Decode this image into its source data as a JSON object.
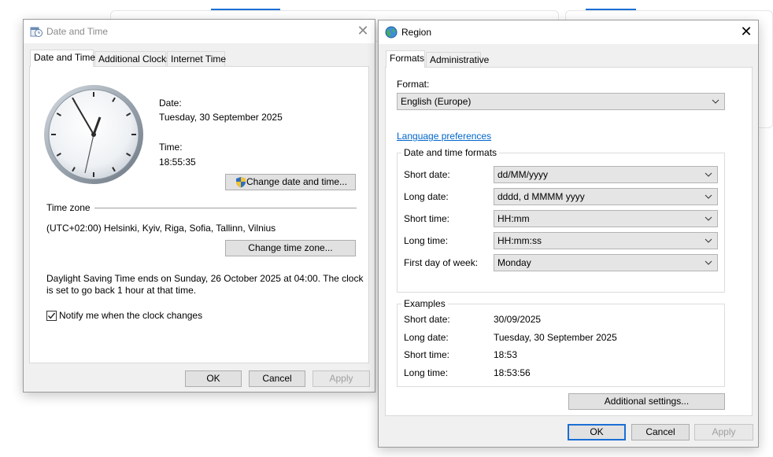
{
  "date_time_dialog": {
    "title": "Date and Time",
    "close": "✕",
    "tabs": [
      "Date and Time",
      "Additional Clocks",
      "Internet Time"
    ],
    "date_label": "Date:",
    "date_value": "Tuesday, 30 September 2025",
    "time_label": "Time:",
    "time_value": "18:55:35",
    "change_date_button": "Change date and time...",
    "time_zone_heading": "Time zone",
    "time_zone_value": "(UTC+02:00) Helsinki, Kyiv, Riga, Sofia, Tallinn, Vilnius",
    "change_zone_button": "Change time zone...",
    "dst_line1": "Daylight Saving Time ends on Sunday, 26 October 2025 at 04:00. The clock",
    "dst_line2": "is set to go back 1 hour at that time.",
    "notify_label": "Notify me when the clock changes",
    "notify_checked": true,
    "ok": "OK",
    "cancel": "Cancel",
    "apply": "Apply"
  },
  "region_dialog": {
    "title": "Region",
    "close": "✕",
    "tabs": [
      "Formats",
      "Administrative"
    ],
    "format_label": "Format:",
    "format_value": "English (Europe)",
    "language_link": "Language preferences",
    "dt_group_title": "Date and time formats",
    "short_date_label": "Short date:",
    "short_date_value": "dd/MM/yyyy",
    "long_date_label": "Long date:",
    "long_date_value": "dddd, d MMMM yyyy",
    "short_time_label": "Short time:",
    "short_time_value": "HH:mm",
    "long_time_label": "Long time:",
    "long_time_value": "HH:mm:ss",
    "first_day_label": "First day of week:",
    "first_day_value": "Monday",
    "examples_title": "Examples",
    "ex_short_date_label": "Short date:",
    "ex_short_date_value": "30/09/2025",
    "ex_long_date_label": "Long date:",
    "ex_long_date_value": "Tuesday, 30 September 2025",
    "ex_short_time_label": "Short time:",
    "ex_short_time_value": "18:53",
    "ex_long_time_label": "Long time:",
    "ex_long_time_value": "18:53:56",
    "additional_settings_button": "Additional settings...",
    "ok": "OK",
    "cancel": "Cancel",
    "apply": "Apply"
  },
  "colors": {
    "accent": "#1a6fd4",
    "link": "#0066cc",
    "dialog_bg": "#f0f0f0"
  }
}
